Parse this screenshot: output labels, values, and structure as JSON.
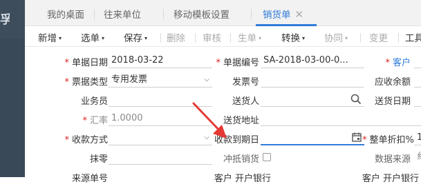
{
  "tabs": [
    {
      "label": "我的桌面",
      "active": false
    },
    {
      "label": "往来单位",
      "active": false
    },
    {
      "label": "移动模板设置",
      "active": false
    },
    {
      "label": "销货单",
      "active": true
    }
  ],
  "tab_close_glyph": "✕",
  "sidebar": {
    "glyph": "孚"
  },
  "toolbar": {
    "items": [
      {
        "label": "新增",
        "caret": true,
        "disabled": false
      },
      {
        "label": "选单",
        "caret": true,
        "disabled": false
      },
      {
        "label": "保存",
        "caret": true,
        "disabled": false
      },
      {
        "label": "删除",
        "caret": false,
        "disabled": true
      },
      {
        "label": "审核",
        "caret": false,
        "disabled": true
      },
      {
        "label": "生单",
        "caret": true,
        "disabled": true
      },
      {
        "label": "转换",
        "caret": true,
        "disabled": false
      },
      {
        "label": "协同",
        "caret": true,
        "disabled": true
      },
      {
        "label": "变更",
        "caret": false,
        "disabled": true
      },
      {
        "label": "工具",
        "caret": false,
        "disabled": false
      }
    ],
    "caret_glyph": "▾"
  },
  "form": {
    "doc_date_label": "单据日期",
    "doc_date_value": "2018-03-22",
    "doc_no_label": "单据编号",
    "doc_no_value": "SA-2018-03-00-0...",
    "customer_label": "客户",
    "invoice_type_label": "票据类型",
    "invoice_type_value": "专用发票",
    "invoice_no_label": "发票号",
    "receivable_label": "应收余额",
    "salesman_label": "业务员",
    "deliverer_label": "送货人",
    "delivery_date_label": "送货日期",
    "rate_label": "汇率",
    "rate_value": "1.0000",
    "delivery_addr_label": "送货地址",
    "collect_method_label": "收款方式",
    "collect_due_label": "收款到期日",
    "discount_label": "整单折扣%",
    "discount_value": "1",
    "rounding_label": "抹零",
    "offset_sales_label": "冲抵销货",
    "data_source_label": "数据来源",
    "data_source_value": "纟",
    "source_no_label": "来源单号",
    "credit_label": "客户 开户银行",
    "contract_label": "客户 开户银行"
  },
  "colors": {
    "accent": "#2f7bd9",
    "required": "#e02020",
    "arrow": "#e53935",
    "sidebar": "#3d4d5c"
  }
}
